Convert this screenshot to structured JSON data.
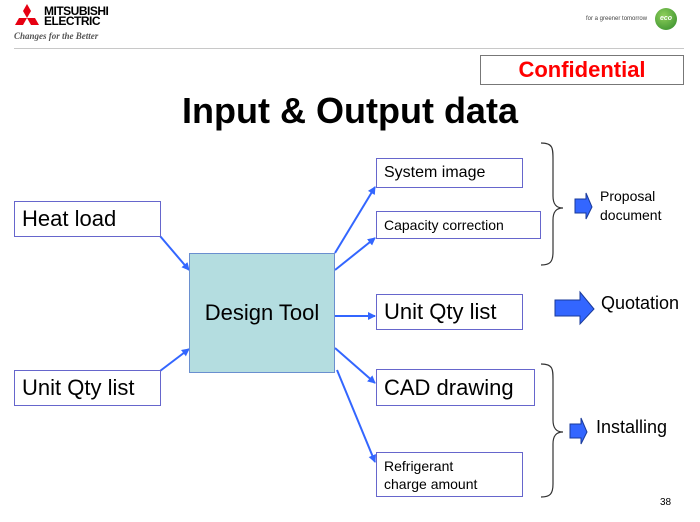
{
  "header": {
    "brand_line1": "MITSUBISHI",
    "brand_line2": "ELECTRIC",
    "tagline": "Changes for the Better",
    "eco_tagline": "for a greener tomorrow",
    "eco_badge": "eco",
    "confidential": "Confidential"
  },
  "slide": {
    "title": "Input & Output data",
    "page_number": "38"
  },
  "inputs": [
    {
      "label": "Heat load"
    },
    {
      "label": "Unit Qty list"
    }
  ],
  "center": {
    "label": "Design Tool"
  },
  "outputs": [
    {
      "label": "System image"
    },
    {
      "label": "Capacity correction"
    },
    {
      "label": "Unit Qty list"
    },
    {
      "label": "CAD drawing"
    },
    {
      "label": "Refrigerant charge amount"
    }
  ],
  "results": [
    {
      "label": "Proposal document"
    },
    {
      "label": "Quotation"
    },
    {
      "label": "Installing"
    }
  ],
  "colors": {
    "arrow": "#3366ff",
    "confidential": "#ff0000",
    "design_tool_fill": "#b4dde0",
    "box_border": "#6666cc"
  }
}
